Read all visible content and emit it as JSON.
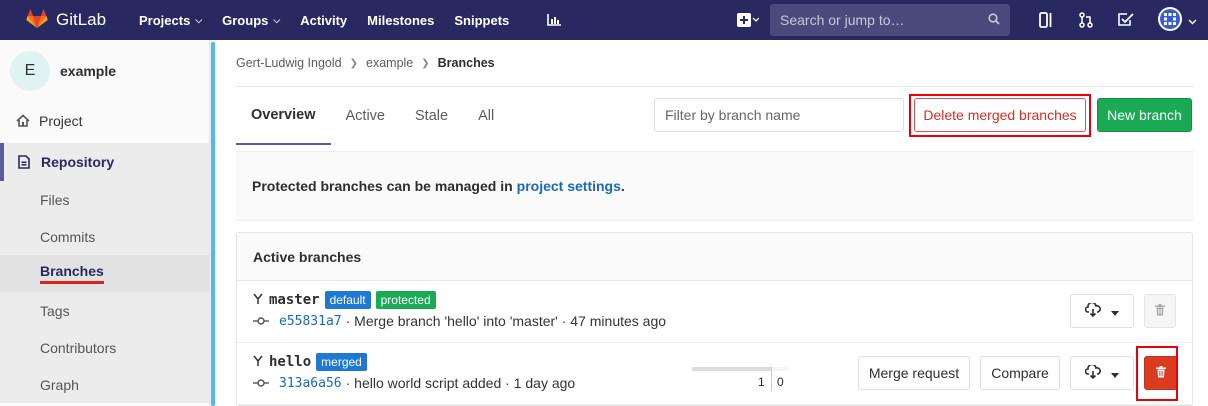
{
  "navbar": {
    "brand": "GitLab",
    "links": [
      "Projects",
      "Groups",
      "Activity",
      "Milestones",
      "Snippets"
    ],
    "search_placeholder": "Search or jump to…"
  },
  "sidebar": {
    "project_initial": "E",
    "project_name": "example",
    "project_label": "Project",
    "repository_label": "Repository",
    "sub_items": [
      "Files",
      "Commits",
      "Branches",
      "Tags",
      "Contributors",
      "Graph"
    ],
    "active_sub_item": "Branches"
  },
  "breadcrumb": {
    "items": [
      "Gert-Ludwig Ingold",
      "example",
      "Branches"
    ]
  },
  "tabs": [
    "Overview",
    "Active",
    "Stale",
    "All"
  ],
  "active_tab": "Overview",
  "filter": {
    "placeholder": "Filter by branch name"
  },
  "buttons": {
    "delete_merged": "Delete merged branches",
    "new_branch": "New branch",
    "merge_request": "Merge request",
    "compare": "Compare"
  },
  "info": {
    "text": "Protected branches can be managed in",
    "link": "project settings",
    "suffix": "."
  },
  "panel": {
    "title": "Active branches",
    "branches": [
      {
        "name": "master",
        "badges": [
          "default",
          "protected"
        ],
        "sha": "e55831a7",
        "message": "· Merge branch 'hello' into 'master' · 47 minutes ago"
      },
      {
        "name": "hello",
        "badges": [
          "merged"
        ],
        "sha": "313a6a56",
        "message": "· hello world script added · 1 day ago",
        "behind": "1",
        "ahead": "0"
      }
    ]
  },
  "colors": {
    "navbar": "#292961",
    "accent": "#5b5ba0",
    "danger": "#db3b21",
    "success": "#1aaa55",
    "link": "#1b69b6"
  }
}
